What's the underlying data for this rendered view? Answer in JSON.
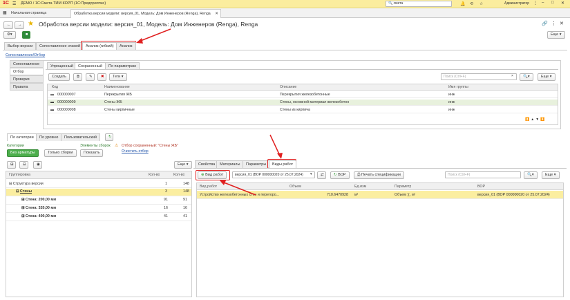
{
  "window": {
    "logo": "1С",
    "title": "ДЕМО / 1С:Смета ТИМ КОРП (1С:Предприятие)",
    "search_value": "смета",
    "user": "Администратор"
  },
  "tabs": {
    "home": "Начальная страница",
    "current": "Обработка версии модели: версия_01, Модель: Дом Инженеров (Renga), Renga"
  },
  "page": {
    "title": "Обработка версии модели: версия_01, Модель: Дом Инженеров (Renga), Renga",
    "more": "Еще"
  },
  "main_tabs": [
    "Выбор версии",
    "Сопоставление этажей",
    "Анализ (гибкий)",
    "Анализ"
  ],
  "section_link": "Сопоставление/Отбор",
  "side_tabs": [
    "Сопоставление",
    "Отбор",
    "Проверки",
    "Правила"
  ],
  "filter_tabs": [
    "Упрощенный",
    "Сохраненный",
    "По параметрам"
  ],
  "filter_toolbar": {
    "create": "Создать",
    "tags": "Теги",
    "search_placeholder": "Поиск (Ctrl+F)",
    "more": "Еще"
  },
  "filter_table": {
    "columns": [
      "Код",
      "Наименование",
      "Описание",
      "Имя группы"
    ],
    "rows": [
      {
        "code": "000000007",
        "name": "Перекрытия ЖБ",
        "desc": "Перекрытия железобетонные",
        "group": "инж"
      },
      {
        "code": "000000009",
        "name": "Стены ЖБ",
        "desc": "Стены, основной материал железобетон",
        "group": "инж"
      },
      {
        "code": "000000008",
        "name": "Стены кирпичные",
        "desc": "Стены из кирпича",
        "group": "инж"
      }
    ]
  },
  "group_tabs": [
    "По категории",
    "По уровню",
    "Пользовательский"
  ],
  "categories": {
    "label": "Категории",
    "mode": "Без арматуры",
    "only_assemblies": "Только сборки",
    "show": "Показать",
    "elements_label": "Элементы сборок",
    "filter_saved": "Отбор сохраненный: \"Стены ЖБ\"",
    "clear_filter": "Очистить отбор",
    "more": "Еще"
  },
  "group_table": {
    "columns": [
      "Группировка",
      "Кол-во",
      "Кол-во"
    ],
    "rows": [
      {
        "name": "Структура версии",
        "c1": "1",
        "c2": "148"
      },
      {
        "name": "Стены",
        "c1": "3",
        "c2": "148"
      },
      {
        "name": "Стена: 200,00 мм",
        "c1": "91",
        "c2": "91"
      },
      {
        "name": "Стена: 320,00 мм",
        "c1": "16",
        "c2": "16"
      },
      {
        "name": "Стена: 400,00 мм",
        "c1": "41",
        "c2": "41"
      }
    ]
  },
  "right_tabs": [
    "Свойства",
    "Материалы",
    "Параметры",
    "Виды работ"
  ],
  "works_toolbar": {
    "add": "Вид работ",
    "version": "версия_01 (ВОР 000000020 от 25.07.2024)",
    "bor": "ВОР",
    "print": "Печать спецификации",
    "search_placeholder": "Поиск (Ctrl+F)",
    "more": "Еще"
  },
  "works_table": {
    "columns": [
      "Вид работ",
      "Объем",
      "Ед.изм",
      "Параметр",
      "ВОР"
    ],
    "rows": [
      {
        "work": "Устройство железобетонных стен и перегоро...",
        "volume": "710.6470928",
        "unit": "м³",
        "param": "Объем ∑, м³",
        "bor": "версия_01 (ВОР 000000020 от 25.07.2024)"
      }
    ]
  },
  "colors": {
    "accent_red": "#e02020",
    "highlight_yellow": "#fbeea0",
    "green": "#4cae4c",
    "titlebar": "#fbed9e"
  }
}
